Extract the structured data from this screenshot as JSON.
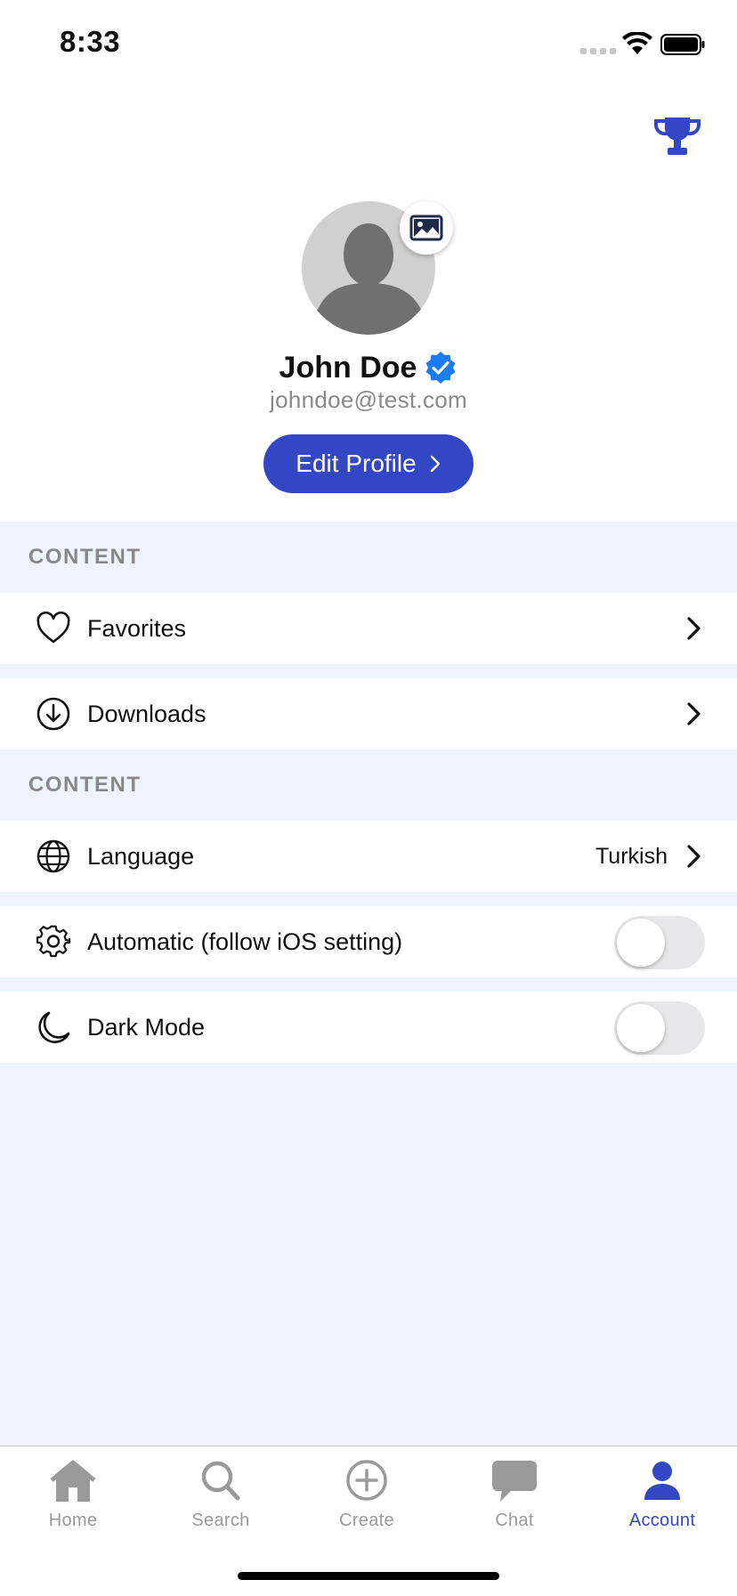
{
  "status": {
    "time": "8:33"
  },
  "profile": {
    "name": "John Doe",
    "email": "johndoe@test.com",
    "edit_label": "Edit Profile"
  },
  "sections": [
    {
      "title": "CONTENT",
      "items": [
        {
          "label": "Favorites",
          "icon": "heart-icon"
        },
        {
          "label": "Downloads",
          "icon": "download-icon"
        }
      ]
    },
    {
      "title": "CONTENT",
      "items": [
        {
          "label": "Language",
          "value": "Turkish",
          "icon": "globe-icon"
        },
        {
          "label": "Automatic (follow iOS setting)",
          "icon": "gear-icon",
          "toggle": false
        },
        {
          "label": "Dark Mode",
          "icon": "moon-icon",
          "toggle": false
        }
      ]
    }
  ],
  "tabs": [
    {
      "label": "Home",
      "icon": "home-icon",
      "active": false
    },
    {
      "label": "Search",
      "icon": "search-icon",
      "active": false
    },
    {
      "label": "Create",
      "icon": "plus-circle-icon",
      "active": false
    },
    {
      "label": "Chat",
      "icon": "chat-icon",
      "active": false
    },
    {
      "label": "Account",
      "icon": "person-icon",
      "active": true
    }
  ],
  "colors": {
    "accent": "#3347c4",
    "verified": "#1a7cf5",
    "background": "#eef4ff",
    "tab_inactive": "#9a9a9a"
  }
}
